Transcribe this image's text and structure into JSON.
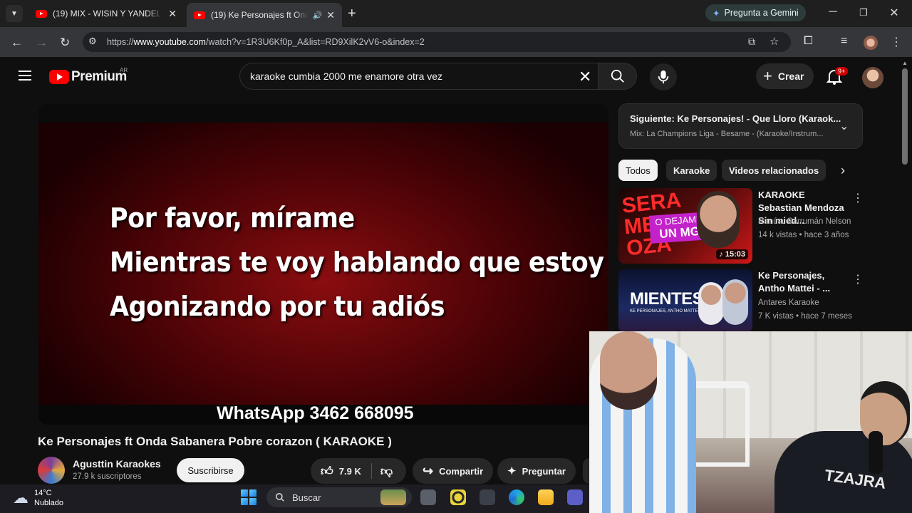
{
  "browser": {
    "tabs": [
      {
        "title": "(19) MIX - WISIN Y YANDEL🔥 (",
        "active": false
      },
      {
        "title": "(19) Ke Personajes ft Onda S",
        "active": true
      }
    ],
    "gemini_label": "Pregunta a Gemini",
    "url_prefix": "https://",
    "url_domain": "www.youtube.com",
    "url_path": "/watch?v=1R3U6Kf0p_A&list=RD9XilK2vV6-o&index=2"
  },
  "youtube": {
    "logo_text": "Premium",
    "region": "AR",
    "search_value": "karaoke cumbia 2000 me enamore otra vez",
    "create_label": "Crear",
    "notif_badge": "9+"
  },
  "video": {
    "lyrics": [
      "Por favor, mírame",
      "Mientras te voy hablando que estoy",
      "Agonizando por tu adiós"
    ],
    "whatsapp": "WhatsApp 3462 668095",
    "title": "Ke Personajes ft Onda Sabanera Pobre corazon ( KARAOKE )",
    "channel": "Agusttin Karaokes",
    "subscribers": "27.9 k suscriptores",
    "subscribe_label": "Suscribirse",
    "likes": "7.9 K",
    "share_label": "Compartir",
    "ask_label": "Preguntar"
  },
  "next_up": {
    "title": "Siguiente: Ke Personajes! - Que Lloro (Karaok...",
    "subtitle": "Mix: La Champions Liga - Besame - (Karaoke/Instrum..."
  },
  "chips": [
    "Todos",
    "Karaoke",
    "Videos relacionados"
  ],
  "recommendations": [
    {
      "title": "KARAOKE Sebastian Mendoza Sin mied...",
      "channel": "Ranúa. Carrumán Nelson",
      "meta": "14 k vistas • hace 3 años",
      "duration": "15:03",
      "thumb_text_1": "SERA MENDOZA",
      "thumb_text_2": "O DEJAME",
      "thumb_text_3": "UN MG"
    },
    {
      "title": "Ke Personajes, Antho Mattei - ...",
      "channel": "Antares Karaoke",
      "meta": "7 K vistas • hace 7 meses",
      "thumb_text_1": "MIENTES",
      "thumb_text_2": "KE PERSONAJES, ANTHO MATTEI"
    }
  ],
  "webcam": {
    "shirt_text": "TZAJRA"
  },
  "taskbar": {
    "temperature": "14°C",
    "weather": "Nublado",
    "search_label": "Buscar"
  },
  "colors": {
    "accent_red": "#ff0000",
    "bg": "#0f0f0f",
    "chip": "#272727"
  }
}
